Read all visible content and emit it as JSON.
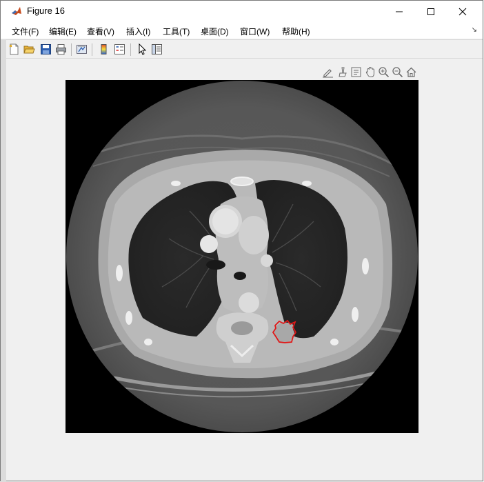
{
  "window": {
    "title": "Figure 16"
  },
  "menu": {
    "items": [
      {
        "label": "文件(F)"
      },
      {
        "label": "编辑(E)"
      },
      {
        "label": "查看(V)"
      },
      {
        "label": "插入(I)"
      },
      {
        "label": "工具(T)"
      },
      {
        "label": "桌面(D)"
      },
      {
        "label": "窗口(W)"
      },
      {
        "label": "帮助(H)"
      }
    ]
  },
  "colors": {
    "contour": "#e01818",
    "accent": "#3a72c4"
  }
}
